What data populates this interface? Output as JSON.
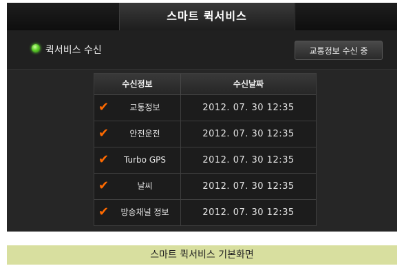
{
  "header": {
    "title": "스마트 퀵서비스"
  },
  "status": {
    "label": "퀵서비스 수신",
    "button_label": "교통정보 수신 중",
    "led_color": "#5fcf2a"
  },
  "table": {
    "headers": [
      "수신정보",
      "수신날짜"
    ],
    "rows": [
      {
        "name": "교통정보",
        "date": "2012. 07. 30 12:35",
        "checked": true
      },
      {
        "name": "안전운전",
        "date": "2012. 07. 30 12:35",
        "checked": true
      },
      {
        "name": "Turbo GPS",
        "date": "2012. 07. 30 12:35",
        "checked": true
      },
      {
        "name": "날씨",
        "date": "2012. 07. 30 12:35",
        "checked": true
      },
      {
        "name": "방송채널 정보",
        "date": "2012. 07. 30 12:35",
        "checked": true
      }
    ],
    "check_color": "#ff6a00"
  },
  "caption": "스마트 퀵서비스 기본화면"
}
